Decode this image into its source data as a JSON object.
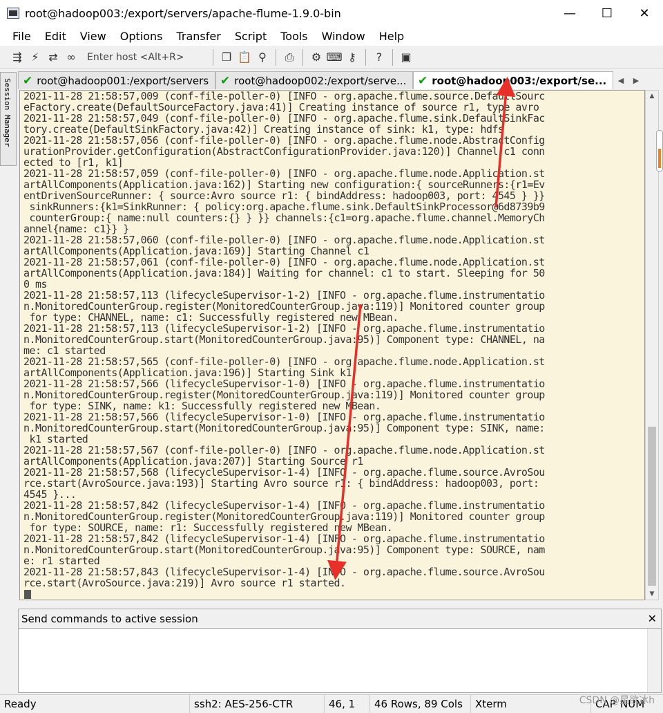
{
  "window": {
    "title": "root@hadoop003:/export/servers/apache-flume-1.9.0-bin",
    "controls": [
      "—",
      "☐",
      "✕"
    ]
  },
  "menu": [
    "File",
    "Edit",
    "View",
    "Options",
    "Transfer",
    "Script",
    "Tools",
    "Window",
    "Help"
  ],
  "toolbar": {
    "host_placeholder": "Enter host <Alt+R>",
    "icons_left": [
      "connect-icon",
      "lightning-icon",
      "reconnect-icon",
      "link-icon"
    ],
    "icons_right": [
      "copy-icon",
      "paste-icon",
      "find-icon",
      "print-icon",
      "settings-icon",
      "keymap-icon",
      "key-icon",
      "help-icon",
      "sftp-icon"
    ]
  },
  "session_manager": {
    "label": "Session Manager"
  },
  "tabs": [
    {
      "label": "root@hadoop001:/export/servers",
      "active": false
    },
    {
      "label": "root@hadoop002:/export/serve...",
      "active": false
    },
    {
      "label": "root@hadoop003:/export/se...",
      "active": true
    }
  ],
  "terminal": {
    "background": "#fbf4dc",
    "lines": [
      "2021-11-28 21:58:57,009 (conf-file-poller-0) [INFO - org.apache.flume.source.DefaultSourc",
      "eFactory.create(DefaultSourceFactory.java:41)] Creating instance of source r1, type avro",
      "2021-11-28 21:58:57,049 (conf-file-poller-0) [INFO - org.apache.flume.sink.DefaultSinkFac",
      "tory.create(DefaultSinkFactory.java:42)] Creating instance of sink: k1, type: hdfs",
      "2021-11-28 21:58:57,056 (conf-file-poller-0) [INFO - org.apache.flume.node.AbstractConfig",
      "urationProvider.getConfiguration(AbstractConfigurationProvider.java:120)] Channel c1 conn",
      "ected to [r1, k1]",
      "2021-11-28 21:58:57,059 (conf-file-poller-0) [INFO - org.apache.flume.node.Application.st",
      "artAllComponents(Application.java:162)] Starting new configuration:{ sourceRunners:{r1=Ev",
      "entDrivenSourceRunner: { source:Avro source r1: { bindAddress: hadoop003, port: 4545 } }}",
      " sinkRunners:{k1=SinkRunner: { policy:org.apache.flume.sink.DefaultSinkProcessor@6d8739b9",
      " counterGroup:{ name:null counters:{} } }} channels:{c1=org.apache.flume.channel.MemoryCh",
      "annel{name: c1}} }",
      "2021-11-28 21:58:57,060 (conf-file-poller-0) [INFO - org.apache.flume.node.Application.st",
      "artAllComponents(Application.java:169)] Starting Channel c1",
      "2021-11-28 21:58:57,061 (conf-file-poller-0) [INFO - org.apache.flume.node.Application.st",
      "artAllComponents(Application.java:184)] Waiting for channel: c1 to start. Sleeping for 50",
      "0 ms",
      "2021-11-28 21:58:57,113 (lifecycleSupervisor-1-2) [INFO - org.apache.flume.instrumentatio",
      "n.MonitoredCounterGroup.register(MonitoredCounterGroup.java:119)] Monitored counter group",
      " for type: CHANNEL, name: c1: Successfully registered new MBean.",
      "2021-11-28 21:58:57,113 (lifecycleSupervisor-1-2) [INFO - org.apache.flume.instrumentatio",
      "n.MonitoredCounterGroup.start(MonitoredCounterGroup.java:95)] Component type: CHANNEL, na",
      "me: c1 started",
      "2021-11-28 21:58:57,565 (conf-file-poller-0) [INFO - org.apache.flume.node.Application.st",
      "artAllComponents(Application.java:196)] Starting Sink k1",
      "2021-11-28 21:58:57,566 (lifecycleSupervisor-1-0) [INFO - org.apache.flume.instrumentatio",
      "n.MonitoredCounterGroup.register(MonitoredCounterGroup.java:119)] Monitored counter group",
      " for type: SINK, name: k1: Successfully registered new MBean.",
      "2021-11-28 21:58:57,566 (lifecycleSupervisor-1-0) [INFO - org.apache.flume.instrumentatio",
      "n.MonitoredCounterGroup.start(MonitoredCounterGroup.java:95)] Component type: SINK, name:",
      " k1 started",
      "2021-11-28 21:58:57,567 (conf-file-poller-0) [INFO - org.apache.flume.node.Application.st",
      "artAllComponents(Application.java:207)] Starting Source r1",
      "2021-11-28 21:58:57,568 (lifecycleSupervisor-1-4) [INFO - org.apache.flume.source.AvroSou",
      "rce.start(AvroSource.java:193)] Starting Avro source r1: { bindAddress: hadoop003, port:",
      "4545 }...",
      "2021-11-28 21:58:57,842 (lifecycleSupervisor-1-4) [INFO - org.apache.flume.instrumentatio",
      "n.MonitoredCounterGroup.register(MonitoredCounterGroup.java:119)] Monitored counter group",
      " for type: SOURCE, name: r1: Successfully registered new MBean.",
      "2021-11-28 21:58:57,842 (lifecycleSupervisor-1-4) [INFO - org.apache.flume.instrumentatio",
      "n.MonitoredCounterGroup.start(MonitoredCounterGroup.java:95)] Component type: SOURCE, nam",
      "e: r1 started",
      "2021-11-28 21:58:57,843 (lifecycleSupervisor-1-4) [INFO - org.apache.flume.source.AvroSou",
      "rce.start(AvroSource.java:219)] Avro source r1 started."
    ]
  },
  "send_panel": {
    "title": "Send commands to active session",
    "close": "✕"
  },
  "status": {
    "ready": "Ready",
    "cipher": "ssh2: AES-256-CTR",
    "cursor_pos": "46,   1",
    "size": "46 Rows, 89 Cols",
    "term": "Xterm",
    "caps": "CAP",
    "num": "NUM"
  },
  "watermark": "CSDN @星欲冰h",
  "annotation_color": "#e8302a"
}
